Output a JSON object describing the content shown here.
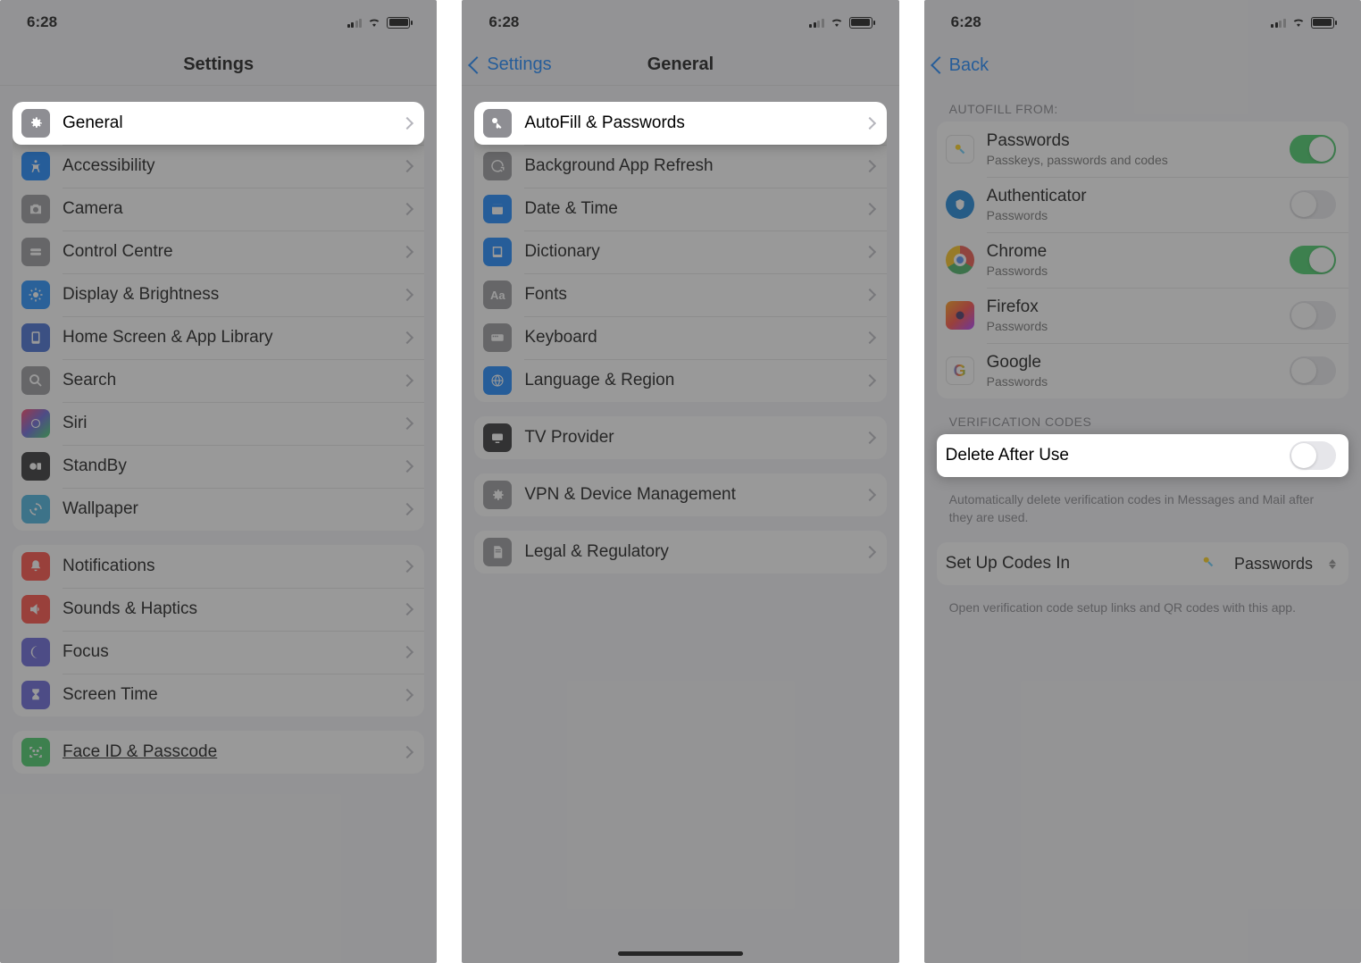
{
  "status": {
    "time": "6:28"
  },
  "screen1": {
    "title": "Settings",
    "highlighted": "General",
    "rows_a": [
      "General",
      "Accessibility",
      "Camera",
      "Control Centre",
      "Display & Brightness",
      "Home Screen & App Library",
      "Search",
      "Siri",
      "StandBy",
      "Wallpaper"
    ],
    "rows_b": [
      "Notifications",
      "Sounds & Haptics",
      "Focus",
      "Screen Time"
    ],
    "rows_c": [
      "Face ID & Passcode"
    ]
  },
  "screen2": {
    "back": "Settings",
    "title": "General",
    "highlighted": "AutoFill & Passwords",
    "rows_a": [
      "AutoFill & Passwords",
      "Background App Refresh",
      "Date & Time",
      "Dictionary",
      "Fonts",
      "Keyboard",
      "Language & Region"
    ],
    "rows_b": [
      "TV Provider"
    ],
    "rows_c": [
      "VPN & Device Management"
    ],
    "rows_d": [
      "Legal & Regulatory"
    ]
  },
  "screen3": {
    "back": "Back",
    "section_autofill": "AUTOFILL FROM:",
    "autofill_items": [
      {
        "title": "Passwords",
        "sub": "Passkeys, passwords and codes",
        "on": true
      },
      {
        "title": "Authenticator",
        "sub": "Passwords",
        "on": false
      },
      {
        "title": "Chrome",
        "sub": "Passwords",
        "on": true
      },
      {
        "title": "Firefox",
        "sub": "Passwords",
        "on": false
      },
      {
        "title": "Google",
        "sub": "Passwords",
        "on": false
      }
    ],
    "section_codes": "VERIFICATION CODES",
    "delete_after_use": "Delete After Use",
    "delete_after_use_on": false,
    "delete_footer": "Automatically delete verification codes in Messages and Mail after they are used.",
    "setup_label": "Set Up Codes In",
    "setup_value": "Passwords",
    "setup_footer": "Open verification code setup links and QR codes with this app."
  }
}
